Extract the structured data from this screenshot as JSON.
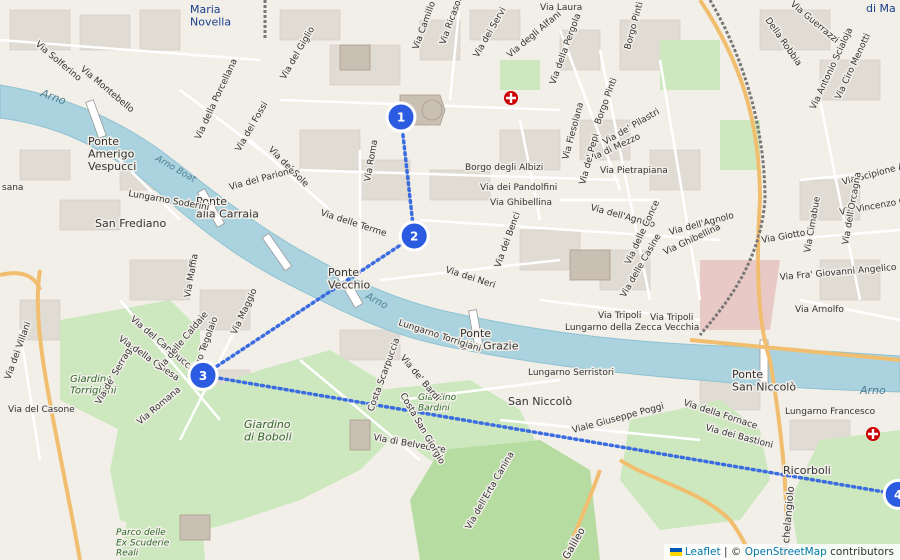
{
  "map": {
    "labels": {
      "station": "Maria\nNovella",
      "top_right": "di Ma",
      "arno_w": "Arno",
      "arno_c": "Arno",
      "arno_e": "Arno",
      "arno_boat": "Arno Boat",
      "ponte_vespucci": "Ponte\nAmerigo\nVespucci",
      "ponte_carraia": "Ponte\nalla Carraia",
      "ponte_vecchio": "Ponte\nVecchio",
      "ponte_grazie": "Ponte\nalle Grazie",
      "ponte_niccolo": "Ponte\nSan Niccolò",
      "san_frediano": "San Frediano",
      "san_niccolo": "San Niccolò",
      "giardino_torrigiani": "Giardino\nTorrigiani",
      "giardino_boboli": "Giardino\ndi Boboli",
      "giardino_bardini": "Giardino\nBardini",
      "parco_scuderie": "Parco delle\nEx Scuderie\nReali",
      "ricorboli": "Ricorboli",
      "borgo_albizi": "Borgo degli Albizi",
      "via_pandolfini": "Via dei Pandolfini",
      "via_ghibellina": "Via Ghibellina",
      "via_agnolo": "Via dell'Agnolo",
      "via_pietrapiana": "Via Pietrapiana",
      "via_tripoli": "Via Tripoli",
      "lungarno_zecca": "Lungarno della Zecca Vecchia",
      "lungarno_serristori": "Lungarno Serristori",
      "lungarno_torrigiani": "Lungarno Torrigiani",
      "lungarno_soderini": "Lungarno Soderini",
      "lungarno_francesco": "Lungarno Francesco",
      "via_poggi": "Viale Giuseppe Poggi",
      "via_fornace": "Via della Fornace",
      "via_bastioni": "Via dei Bastioni",
      "via_belvedere": "Via di Belvedere",
      "via_roma": "Via Roma",
      "via_terme": "Via delle Terme",
      "via_neri": "Via dei Neri",
      "via_bardi": "Via de' Bardi",
      "via_maggio": "Via Maggio",
      "via_serragli": "Via de' Serragli",
      "via_romana": "Via Romana",
      "via_mazzetta": "Via Mazzetta",
      "via_sole": "Via del Sole",
      "via_fossi": "Via dei Fossi",
      "via_parione": "Via del Parione",
      "via_porcellana": "Via della Porcellana",
      "via_palazzuolo": "Via Palazzuolo",
      "via_montebello": "Via Montebello",
      "via_solferino": "Via Solferino",
      "via_giglio": "Via del Giglio",
      "via_ricasoli": "Via Ricasoli",
      "via_servi": "Via dei Servi",
      "via_alfani": "Via degli Alfani",
      "via_pergola": "Via della Pergola",
      "borgo_pinti": "Borgo Pinti",
      "via_pilastri": "Via de' Pilastri",
      "via_mezzo": "Via di Mezzo",
      "via_pepi": "Via de' Pepi",
      "via_fiesolana": "Via Fiesolana",
      "via_scipione": "Via Scipione A",
      "via_vincenzo": "Via Vincenzo Gio",
      "via_giotto": "Via Giotto",
      "via_orcagna": "Via dell'Orcagna",
      "via_angelico": "Via Fra' Giovanni Angelico",
      "via_arnolfo": "Via Arnolfo",
      "via_cimabue": "Via Cimabue",
      "via_cherubini": "Via Cherubini",
      "via_campuccio": "Via del Campuccio",
      "via_chiesa": "Via della Chiesa",
      "via_caldaie": "Via delle Caldaie",
      "borgo_tegolaio": "Borgo Tegolaio",
      "via_villani": "Via dei Villani",
      "via_casone": "Via del Casone",
      "costa_scarpuccia": "Costa Scarpuccia",
      "costa_san_giorgio": "Costa San Giorgio",
      "via_erta_canina": "Via dell'Erta Canina",
      "viale_galileo": "Galileo",
      "via_michelangiolo": "Michelangiolo",
      "via_bentaccordi": "Via dei Benci",
      "via_laura": "Via Laura",
      "via_pinti": "Borgo Pinti",
      "via_della_robbia": "Della Robbia",
      "via_guerrazzi": "Via Guerrazzi",
      "via_ciro_menotti": "Via Ciro Menotti",
      "via_antonio": "Via Antonio Scialoja",
      "via_camillo": "Via Camillo Ca",
      "via_corse": "Via delle Conce",
      "via_casine": "Via delle Casine",
      "via_ghibellina_e": "Via Ghibellina",
      "via_agnolo_e": "Via dell'Agnolo",
      "via_mafia": "Via Maffia",
      "via_sanza": "Via Santa",
      "via_orsine": "sana"
    },
    "markers": [
      {
        "number": "1",
        "lat": 43.7731,
        "lon": 11.2542
      },
      {
        "number": "2",
        "lat": 43.7696,
        "lon": 11.2545
      },
      {
        "number": "3",
        "lat": 43.7655,
        "lon": 11.2497
      },
      {
        "number": "4",
        "lat": 43.762,
        "lon": 11.2655
      }
    ],
    "route_color": "#3b6de0",
    "marker_color": "#2b5be0"
  },
  "attribution": {
    "leaflet_label": "Leaflet",
    "separator": " | © ",
    "osm_label": "OpenStreetMap",
    "suffix": " contributors"
  }
}
